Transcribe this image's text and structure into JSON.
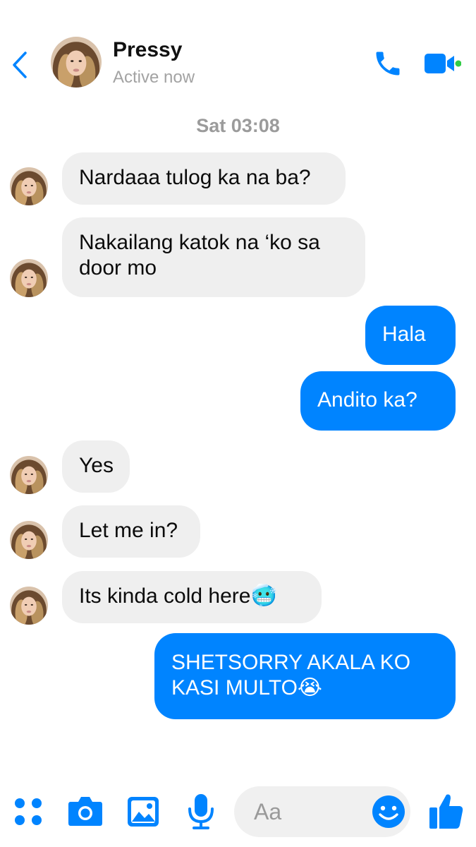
{
  "header": {
    "contact_name": "Pressy",
    "status": "Active now"
  },
  "conversation": {
    "timestamp": "Sat 03:08",
    "messages": [
      {
        "from": "them",
        "text": "Nardaaa tulog ka na ba?"
      },
      {
        "from": "them",
        "text": "Nakailang katok na ‘ko sa\ndoor mo"
      },
      {
        "from": "me",
        "text": "Hala"
      },
      {
        "from": "me",
        "text": "Andito ka?"
      },
      {
        "from": "them",
        "text": "Yes"
      },
      {
        "from": "them",
        "text": "Let me in?"
      },
      {
        "from": "them",
        "text": "Its kinda cold here🥶"
      },
      {
        "from": "me",
        "text": "SHETSORRY AKALA KO\nKASI MULTO😭"
      }
    ]
  },
  "composer": {
    "placeholder": "Aa",
    "icons": [
      "apps-icon",
      "camera-icon",
      "gallery-icon",
      "microphone-icon",
      "emoji-icon",
      "thumbs-up-icon"
    ]
  },
  "colors": {
    "accent": "#0084ff",
    "incoming_bubble": "#efefef",
    "online_dot": "#31cc46"
  }
}
